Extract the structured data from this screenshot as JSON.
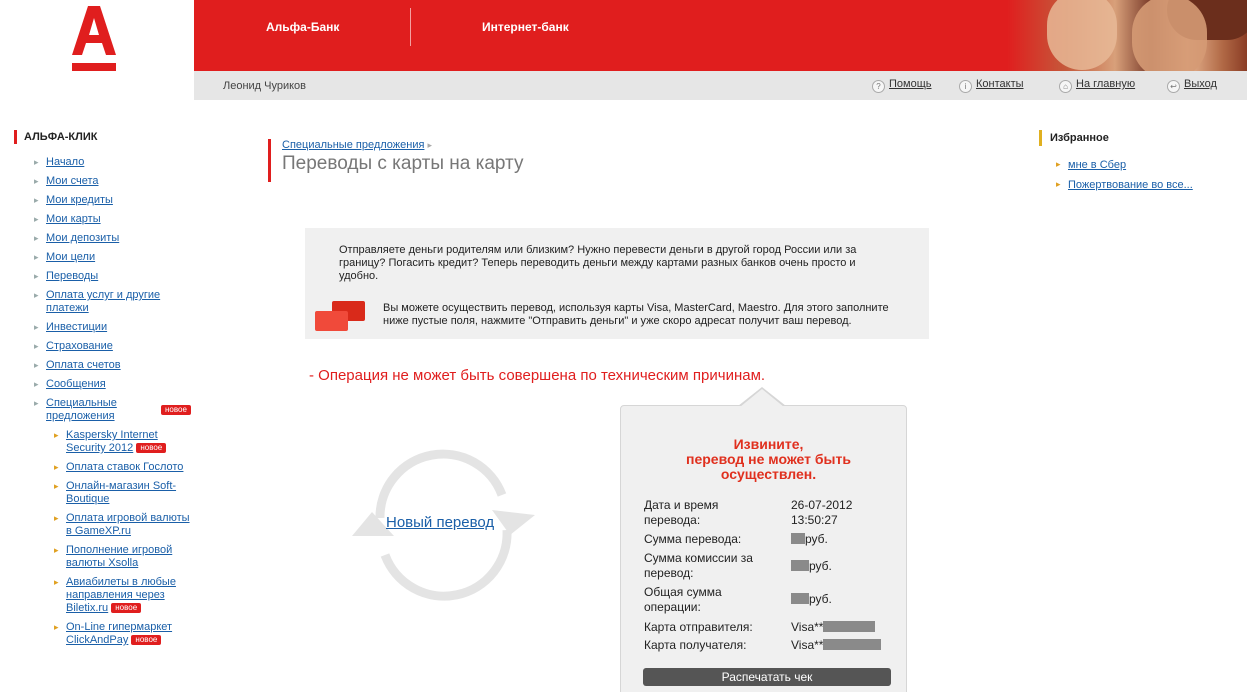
{
  "header": {
    "bank_name": "Альфа-Банк",
    "internet_bank": "Интернет-банк",
    "brand_color": "#e01e1e"
  },
  "topbar": {
    "user_name": "Леонид Чуриков",
    "links": [
      {
        "label": "Помощь",
        "icon": "help-icon",
        "glyph": "?"
      },
      {
        "label": "Контакты",
        "icon": "info-icon",
        "glyph": "i"
      },
      {
        "label": "На главную",
        "icon": "home-icon",
        "glyph": "⌂"
      },
      {
        "label": "Выход",
        "icon": "exit-icon",
        "glyph": "↩"
      }
    ]
  },
  "sidebar": {
    "title": "АЛЬФА-КЛИК",
    "items": [
      {
        "label": "Начало"
      },
      {
        "label": "Мои счета"
      },
      {
        "label": "Мои кредиты"
      },
      {
        "label": "Мои карты"
      },
      {
        "label": "Мои депозиты"
      },
      {
        "label": "Мои цели"
      },
      {
        "label": "Переводы"
      },
      {
        "label": "Оплата услуг и другие платежи"
      },
      {
        "label": "Инвестиции"
      },
      {
        "label": "Страхование"
      },
      {
        "label": "Оплата счетов"
      },
      {
        "label": "Сообщения"
      },
      {
        "label": "Специальные предложения",
        "badge": "новое"
      }
    ],
    "subitems": [
      {
        "label": "Kaspersky Internet Security 2012",
        "badge": "новое"
      },
      {
        "label": "Оплата ставок Гослото"
      },
      {
        "label": "Онлайн-магазин Soft-Boutique"
      },
      {
        "label": "Оплата игровой валюты в GameXP.ru"
      },
      {
        "label": "Пополнение игровой валюты Xsolla"
      },
      {
        "label": "Авиабилеты в любые направления через Biletix.ru",
        "badge": "новое"
      },
      {
        "label": "On-Line гипермаркет ClickAndPay",
        "badge": "новое"
      }
    ]
  },
  "breadcrumb": {
    "parent": "Специальные предложения",
    "title": "Переводы с карты на карту"
  },
  "favorites": {
    "title": "Избранное",
    "items": [
      "мне в Сбер",
      "Пожертвование во все..."
    ]
  },
  "info": {
    "paragraph1": "Отправляете деньги родителям или близким? Нужно перевести деньги в другой город России или за границу? Погасить кредит? Теперь переводить деньги между картами разных банков очень просто и удобно.",
    "paragraph2": "Вы можете осуществить перевод, используя карты Visa, MasterCard, Maestro. Для этого заполните ниже пустые поля, нажмите \"Отправить деньги\" и уже скоро адресат получит ваш перевод."
  },
  "error": "- Операция не может быть совершена по техническим причинам.",
  "new_transfer": "Новый перевод",
  "receipt": {
    "title_line1": "Извините,",
    "title_line2": "перевод не может быть",
    "title_line3": "осуществлен.",
    "date_label": "Дата и время перевода:",
    "date_value": "26-07-2012",
    "time_value": "13:50:27",
    "amount_label": "Сумма перевода:",
    "amount_value": "руб.",
    "commission_label": "Сумма комиссии за перевод:",
    "commission_value": "руб.",
    "total_label": "Общая сумма операции:",
    "total_value": "руб.",
    "sender_label": "Карта отправителя:",
    "sender_value": "Visa**",
    "receiver_label": "Карта получателя:",
    "receiver_value": "Visa**",
    "print_button": "Распечатать чек"
  }
}
